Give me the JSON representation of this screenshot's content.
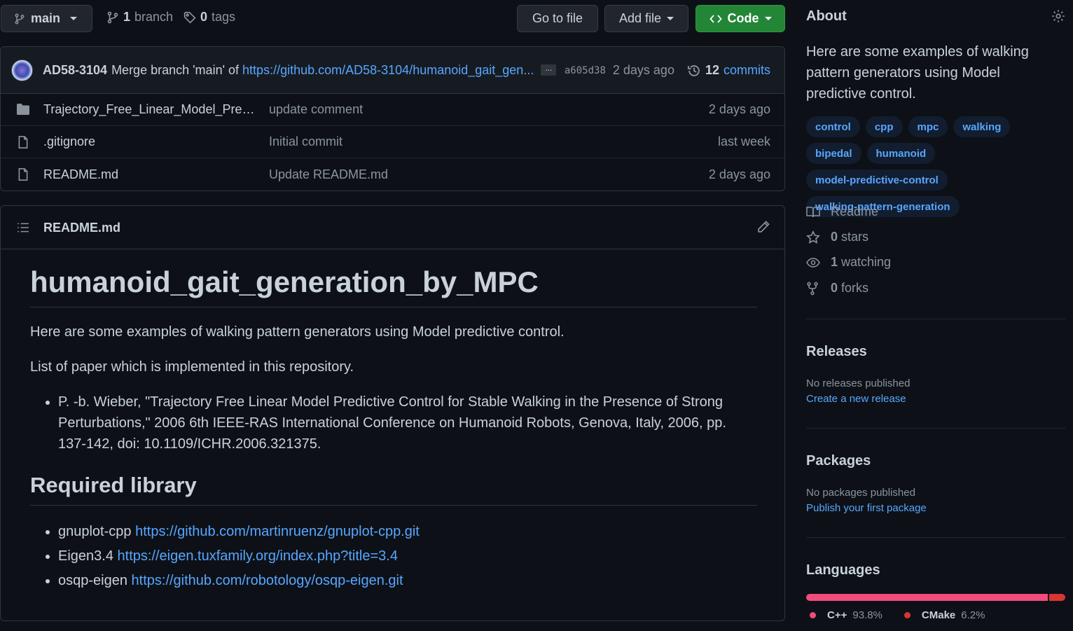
{
  "branch_selector": {
    "label": "main"
  },
  "branches": {
    "count": "1",
    "label": "branch"
  },
  "tags": {
    "count": "0",
    "label": "tags"
  },
  "actions": {
    "go_to_file": "Go to file",
    "add_file": "Add file",
    "code": "Code"
  },
  "latest_commit": {
    "author": "AD58-3104",
    "message": "Merge branch 'main' of",
    "url_text": "https://github.com/AD58-3104/humanoid_gait_gen...",
    "ellipsis": "...",
    "sha": "a605d38",
    "age": "2 days ago",
    "commits_count": "12",
    "commits_label": "commits"
  },
  "files": [
    {
      "type": "folder",
      "name": "Trajectory_Free_Linear_Model_Predict...",
      "commit": "update comment",
      "age": "2 days ago"
    },
    {
      "type": "file",
      "name": ".gitignore",
      "commit": "Initial commit",
      "age": "last week"
    },
    {
      "type": "file",
      "name": "README.md",
      "commit": "Update README.md",
      "age": "2 days ago"
    }
  ],
  "readme": {
    "filename": "README.md",
    "h1": "humanoid_gait_generation_by_MPC",
    "intro": "Here are some examples of walking pattern generators using Model predictive control.",
    "papers_intro": "List of paper which is implemented in this repository.",
    "papers": [
      "P. -b. Wieber, \"Trajectory Free Linear Model Predictive Control for Stable Walking in the Presence of Strong Perturbations,\" 2006 6th IEEE-RAS International Conference on Humanoid Robots, Genova, Italy, 2006, pp. 137-142, doi: 10.1109/ICHR.2006.321375."
    ],
    "h2": "Required library",
    "libraries": [
      {
        "name": "gnuplot-cpp",
        "url": "https://github.com/martinruenz/gnuplot-cpp.git"
      },
      {
        "name": "Eigen3.4",
        "url": "https://eigen.tuxfamily.org/index.php?title=3.4"
      },
      {
        "name": "osqp-eigen",
        "url": "https://github.com/robotology/osqp-eigen.git"
      }
    ]
  },
  "about": {
    "title": "About",
    "description": "Here are some examples of walking pattern generators using Model predictive control.",
    "topics": [
      "control",
      "cpp",
      "mpc",
      "walking",
      "bipedal",
      "humanoid",
      "model-predictive-control",
      "walking-pattern-generation"
    ],
    "readme_label": "Readme",
    "stars_count": "0",
    "stars_label": "stars",
    "watching_count": "1",
    "watching_label": "watching",
    "forks_count": "0",
    "forks_label": "forks"
  },
  "releases": {
    "title": "Releases",
    "text": "No releases published",
    "link": "Create a new release"
  },
  "packages": {
    "title": "Packages",
    "text": "No packages published",
    "link": "Publish your first package"
  },
  "languages": {
    "title": "Languages",
    "items": [
      {
        "name": "C++",
        "percent": "93.8%",
        "value": 93.8,
        "color": "#f34b7d"
      },
      {
        "name": "CMake",
        "percent": "6.2%",
        "value": 6.2,
        "color": "#da3434"
      }
    ]
  },
  "colors": {
    "accent": "#58a6ff",
    "code_button": "#238636",
    "background": "#0d1117"
  }
}
